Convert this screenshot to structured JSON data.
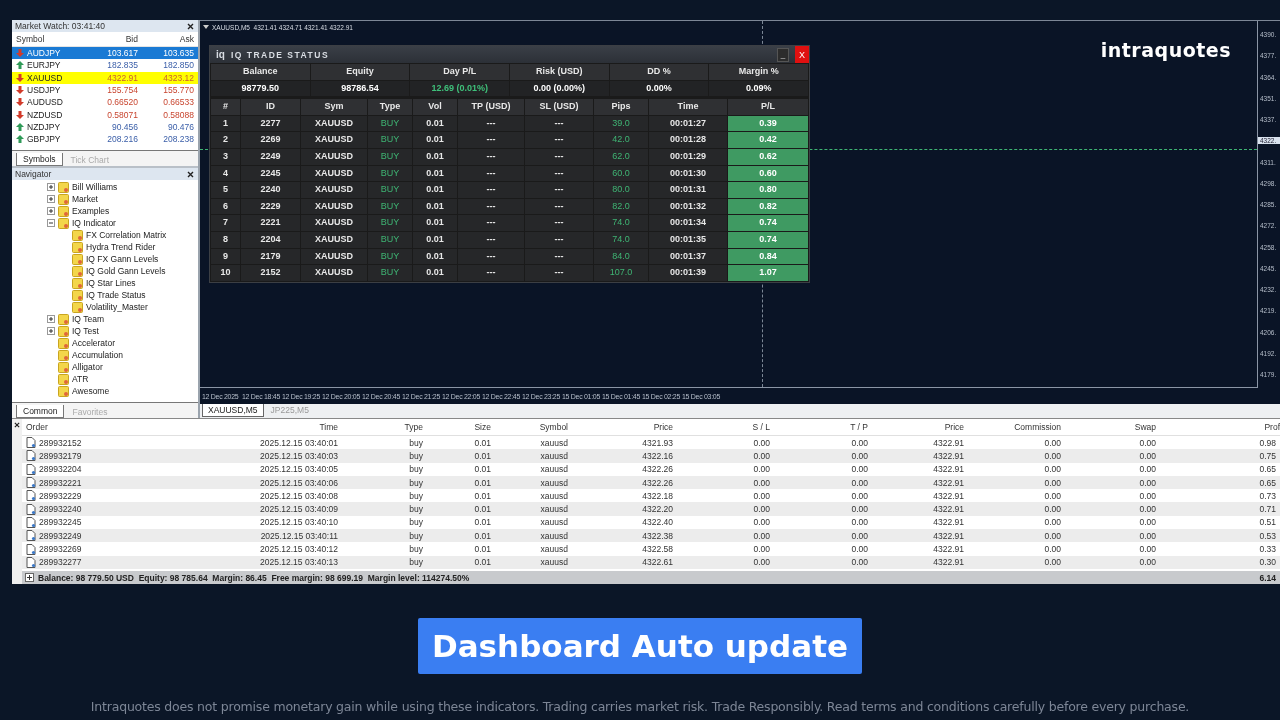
{
  "market_watch": {
    "title": "Market Watch: 03:41:40",
    "columns": [
      "Symbol",
      "Bid",
      "Ask"
    ],
    "rows": [
      {
        "symbol": "AUDJPY",
        "bid": "103.617",
        "ask": "103.635",
        "kind": "down",
        "selected": true,
        "highlight": false
      },
      {
        "symbol": "EURJPY",
        "bid": "182.835",
        "ask": "182.850",
        "kind": "up",
        "selected": false,
        "highlight": false
      },
      {
        "symbol": "XAUUSD",
        "bid": "4322.91",
        "ask": "4323.12",
        "kind": "down",
        "selected": false,
        "highlight": true
      },
      {
        "symbol": "USDJPY",
        "bid": "155.754",
        "ask": "155.770",
        "kind": "down",
        "selected": false,
        "highlight": false
      },
      {
        "symbol": "AUDUSD",
        "bid": "0.66520",
        "ask": "0.66533",
        "kind": "down",
        "selected": false,
        "highlight": false
      },
      {
        "symbol": "NZDUSD",
        "bid": "0.58071",
        "ask": "0.58088",
        "kind": "down",
        "selected": false,
        "highlight": false
      },
      {
        "symbol": "NZDJPY",
        "bid": "90.456",
        "ask": "90.476",
        "kind": "up",
        "selected": false,
        "highlight": false
      },
      {
        "symbol": "GBPJPY",
        "bid": "208.216",
        "ask": "208.238",
        "kind": "up",
        "selected": false,
        "highlight": false
      }
    ],
    "tabs": [
      {
        "label": "Symbols",
        "selected": true
      },
      {
        "label": "Tick Chart",
        "selected": false
      }
    ]
  },
  "navigator": {
    "title": "Navigator",
    "items": [
      {
        "label": "Bill Williams",
        "expanded": false
      },
      {
        "label": "Market",
        "expanded": false
      },
      {
        "label": "Examples",
        "expanded": false
      },
      {
        "label": "IQ Indicator",
        "expanded": true,
        "children": [
          {
            "label": "FX Correlation Matrix"
          },
          {
            "label": "Hydra Trend Rider"
          },
          {
            "label": "IQ FX Gann Levels"
          },
          {
            "label": "IQ Gold Gann Levels"
          },
          {
            "label": "IQ Star Lines"
          },
          {
            "label": "IQ Trade Status"
          },
          {
            "label": "Volatility_Master"
          }
        ]
      },
      {
        "label": "IQ Team",
        "expanded": false
      },
      {
        "label": "IQ Test",
        "expanded": false
      },
      {
        "label": "Accelerator"
      },
      {
        "label": "Accumulation"
      },
      {
        "label": "Alligator"
      },
      {
        "label": "ATR"
      },
      {
        "label": "Awesome"
      }
    ],
    "tabs": [
      {
        "label": "Common",
        "selected": true
      },
      {
        "label": "Favorites",
        "selected": false
      }
    ]
  },
  "chart": {
    "header": "XAUUSD,M5  4321.41 4324.71 4321.41 4322.91",
    "logo": "intraquotes",
    "price_axis": [
      {
        "label": "4390.",
        "current": false
      },
      {
        "label": "4377.",
        "current": false
      },
      {
        "label": "4364.",
        "current": false
      },
      {
        "label": "4351.",
        "current": false
      },
      {
        "label": "4337.",
        "current": false
      },
      {
        "label": "4322.",
        "current": true
      },
      {
        "label": "4311.",
        "current": false
      },
      {
        "label": "4298.",
        "current": false
      },
      {
        "label": "4285.",
        "current": false
      },
      {
        "label": "4272.",
        "current": false
      },
      {
        "label": "4258.",
        "current": false
      },
      {
        "label": "4245.",
        "current": false
      },
      {
        "label": "4232.",
        "current": false
      },
      {
        "label": "4219.",
        "current": false
      },
      {
        "label": "4206.",
        "current": false
      },
      {
        "label": "4192.",
        "current": false
      },
      {
        "label": "4179.",
        "current": false
      }
    ],
    "time_axis": [
      "12 Dec 2025",
      "12 Dec 18:45",
      "12 Dec 19:25",
      "12 Dec 20:05",
      "12 Dec 20:45",
      "12 Dec 21:25",
      "12 Dec 22:05",
      "12 Dec 22:45",
      "12 Dec 23:25",
      "15 Dec 01:05",
      "15 Dec 01:45",
      "15 Dec 02:25",
      "15 Dec 03:05"
    ],
    "tabs": [
      {
        "label": "XAUUSD,M5",
        "selected": true
      },
      {
        "label": "JP225,M5",
        "selected": false
      }
    ]
  },
  "dashboard": {
    "logo": "iq",
    "title": "IQ TRADE STATUS",
    "minimize": "_",
    "close": "X",
    "summary": [
      {
        "label": "Balance",
        "value": "98779.50",
        "highlight": false
      },
      {
        "label": "Equity",
        "value": "98786.54",
        "highlight": false
      },
      {
        "label": "Day P/L",
        "value": "12.69 (0.01%)",
        "highlight": true
      },
      {
        "label": "Risk (USD)",
        "value": "0.00 (0.00%)",
        "highlight": false
      },
      {
        "label": "DD %",
        "value": "0.00%",
        "highlight": false
      },
      {
        "label": "Margin %",
        "value": "0.09%",
        "highlight": false
      }
    ],
    "columns": [
      "#",
      "ID",
      "Sym",
      "Type",
      "Vol",
      "TP (USD)",
      "SL (USD)",
      "Pips",
      "Time",
      "P/L"
    ],
    "rows": [
      [
        "1",
        "2277",
        "XAUUSD",
        "BUY",
        "0.01",
        "---",
        "---",
        "39.0",
        "00:01:27",
        "0.39"
      ],
      [
        "2",
        "2269",
        "XAUUSD",
        "BUY",
        "0.01",
        "---",
        "---",
        "42.0",
        "00:01:28",
        "0.42"
      ],
      [
        "3",
        "2249",
        "XAUUSD",
        "BUY",
        "0.01",
        "---",
        "---",
        "62.0",
        "00:01:29",
        "0.62"
      ],
      [
        "4",
        "2245",
        "XAUUSD",
        "BUY",
        "0.01",
        "---",
        "---",
        "60.0",
        "00:01:30",
        "0.60"
      ],
      [
        "5",
        "2240",
        "XAUUSD",
        "BUY",
        "0.01",
        "---",
        "---",
        "80.0",
        "00:01:31",
        "0.80"
      ],
      [
        "6",
        "2229",
        "XAUUSD",
        "BUY",
        "0.01",
        "---",
        "---",
        "82.0",
        "00:01:32",
        "0.82"
      ],
      [
        "7",
        "2221",
        "XAUUSD",
        "BUY",
        "0.01",
        "---",
        "---",
        "74.0",
        "00:01:34",
        "0.74"
      ],
      [
        "8",
        "2204",
        "XAUUSD",
        "BUY",
        "0.01",
        "---",
        "---",
        "74.0",
        "00:01:35",
        "0.74"
      ],
      [
        "9",
        "2179",
        "XAUUSD",
        "BUY",
        "0.01",
        "---",
        "---",
        "84.0",
        "00:01:37",
        "0.84"
      ],
      [
        "10",
        "2152",
        "XAUUSD",
        "BUY",
        "0.01",
        "---",
        "---",
        "107.0",
        "00:01:39",
        "1.07"
      ]
    ]
  },
  "terminal": {
    "columns": [
      "Order",
      "Time",
      "Type",
      "Size",
      "Symbol",
      "Price",
      "S / L",
      "T / P",
      "Price",
      "Commission",
      "Swap",
      "Prof"
    ],
    "rows": [
      [
        "289932152",
        "2025.12.15 03:40:01",
        "buy",
        "0.01",
        "xauusd",
        "4321.93",
        "0.00",
        "0.00",
        "4322.91",
        "0.00",
        "0.00",
        "0.98"
      ],
      [
        "289932179",
        "2025.12.15 03:40:03",
        "buy",
        "0.01",
        "xauusd",
        "4322.16",
        "0.00",
        "0.00",
        "4322.91",
        "0.00",
        "0.00",
        "0.75"
      ],
      [
        "289932204",
        "2025.12.15 03:40:05",
        "buy",
        "0.01",
        "xauusd",
        "4322.26",
        "0.00",
        "0.00",
        "4322.91",
        "0.00",
        "0.00",
        "0.65"
      ],
      [
        "289932221",
        "2025.12.15 03:40:06",
        "buy",
        "0.01",
        "xauusd",
        "4322.26",
        "0.00",
        "0.00",
        "4322.91",
        "0.00",
        "0.00",
        "0.65"
      ],
      [
        "289932229",
        "2025.12.15 03:40:08",
        "buy",
        "0.01",
        "xauusd",
        "4322.18",
        "0.00",
        "0.00",
        "4322.91",
        "0.00",
        "0.00",
        "0.73"
      ],
      [
        "289932240",
        "2025.12.15 03:40:09",
        "buy",
        "0.01",
        "xauusd",
        "4322.20",
        "0.00",
        "0.00",
        "4322.91",
        "0.00",
        "0.00",
        "0.71"
      ],
      [
        "289932245",
        "2025.12.15 03:40:10",
        "buy",
        "0.01",
        "xauusd",
        "4322.40",
        "0.00",
        "0.00",
        "4322.91",
        "0.00",
        "0.00",
        "0.51"
      ],
      [
        "289932249",
        "2025.12.15 03:40:11",
        "buy",
        "0.01",
        "xauusd",
        "4322.38",
        "0.00",
        "0.00",
        "4322.91",
        "0.00",
        "0.00",
        "0.53"
      ],
      [
        "289932269",
        "2025.12.15 03:40:12",
        "buy",
        "0.01",
        "xauusd",
        "4322.58",
        "0.00",
        "0.00",
        "4322.91",
        "0.00",
        "0.00",
        "0.33"
      ],
      [
        "289932277",
        "2025.12.15 03:40:13",
        "buy",
        "0.01",
        "xauusd",
        "4322.61",
        "0.00",
        "0.00",
        "4322.91",
        "0.00",
        "0.00",
        "0.30"
      ]
    ],
    "footer": {
      "summary": "Balance: 98 779.50 USD  Equity: 98 785.64  Margin: 86.45  Free margin: 98 699.19  Margin level: 114274.50%",
      "total": "6.14"
    }
  },
  "caption": {
    "button": "Dashboard Auto update",
    "disclaimer": "Intraquotes does not promise monetary gain while using these indicators. Trading carries market risk. Trade Responsibly. Read terms and conditions carefully before every purchase."
  }
}
